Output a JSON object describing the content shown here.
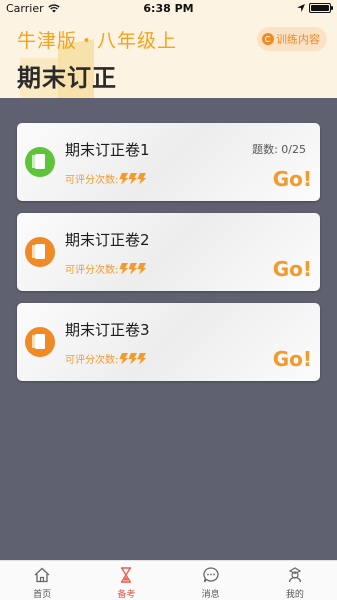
{
  "status_bar": {
    "carrier": "Carrier",
    "time": "6:38 PM"
  },
  "header": {
    "book_title": "牛津版・八年级上",
    "page_title": "期末订正",
    "training_button": "训练内容"
  },
  "cards": [
    {
      "title": "期末订正卷1",
      "count_label": "题数: 0/25",
      "eval_label": "可评分次数:",
      "go_label": "Go!",
      "icon_color": "#5ec43a"
    },
    {
      "title": "期末订正卷2",
      "eval_label": "可评分次数:",
      "go_label": "Go!",
      "icon_color": "#f08a24"
    },
    {
      "title": "期末订正卷3",
      "eval_label": "可评分次数:",
      "go_label": "Go!",
      "icon_color": "#f08a24"
    }
  ],
  "tabs": [
    {
      "label": "首页",
      "icon": "home-icon",
      "active": false
    },
    {
      "label": "备考",
      "icon": "hourglass-icon",
      "active": true
    },
    {
      "label": "消息",
      "icon": "message-icon",
      "active": false
    },
    {
      "label": "我的",
      "icon": "profile-icon",
      "active": false
    }
  ],
  "colors": {
    "accent": "#f39a2b",
    "header_bg": "#fdf3e2",
    "page_bg": "#5f6070",
    "active_tab": "#e95a4a"
  }
}
